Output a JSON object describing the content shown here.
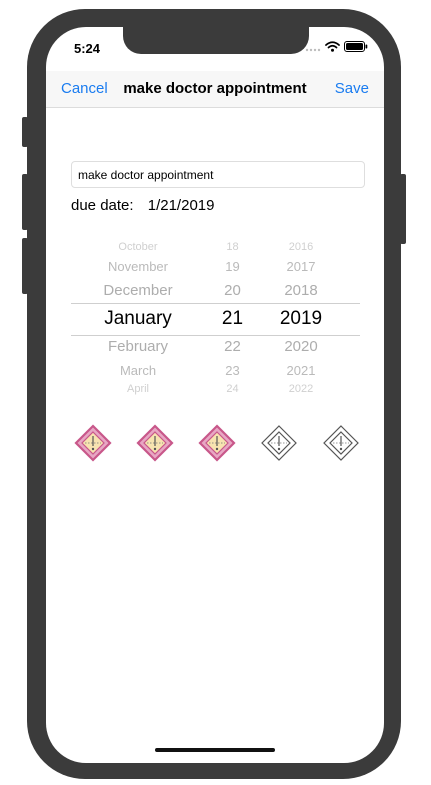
{
  "status_bar": {
    "time": "5:24"
  },
  "nav": {
    "cancel_label": "Cancel",
    "title": "make doctor appointment",
    "save_label": "Save"
  },
  "form": {
    "title_value": "make doctor appointment",
    "due_label": "due date:",
    "due_value": "1/21/2019"
  },
  "picker": {
    "months": [
      "October",
      "November",
      "December",
      "January",
      "February",
      "March",
      "April"
    ],
    "days": [
      "18",
      "19",
      "20",
      "21",
      "22",
      "23",
      "24"
    ],
    "years": [
      "2016",
      "2017",
      "2018",
      "2019",
      "2020",
      "2021",
      "2022"
    ],
    "selected_index": 3
  },
  "priority": {
    "selected_count": 3,
    "total": 5,
    "active_fill": "#f7e3b0",
    "active_stroke": "#c8578a",
    "inactive_stroke": "#555555"
  }
}
